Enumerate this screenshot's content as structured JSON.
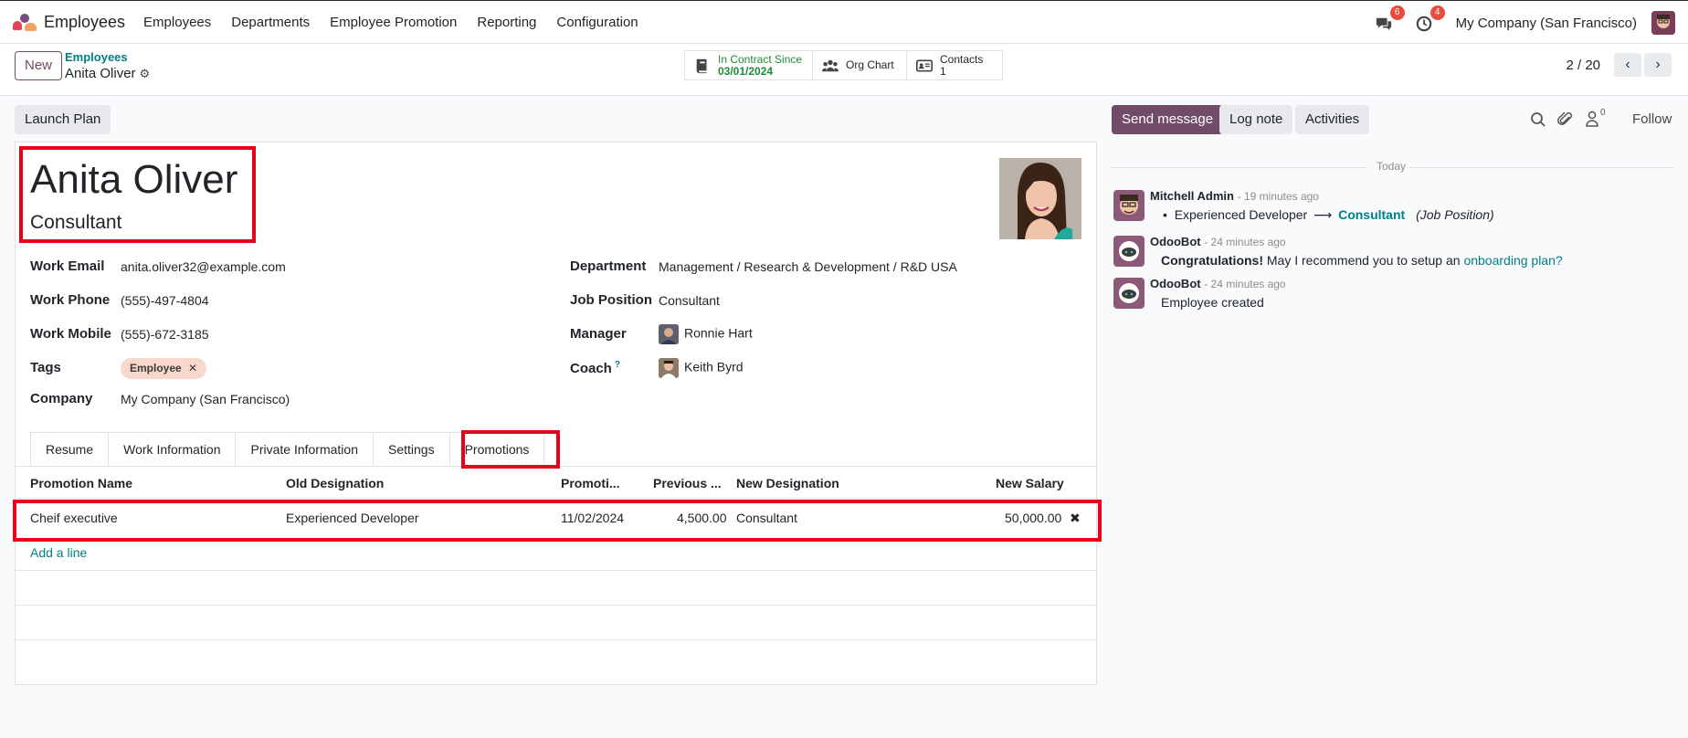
{
  "navbar": {
    "app_name": "Employees",
    "menu": [
      "Employees",
      "Departments",
      "Employee Promotion",
      "Reporting",
      "Configuration"
    ],
    "messages_badge": "6",
    "activities_badge": "4",
    "company": "My Company (San Francisco)"
  },
  "control": {
    "new_label": "New",
    "breadcrumb_parent": "Employees",
    "breadcrumb_current": "Anita Oliver",
    "smart_contract_label": "In Contract Since",
    "smart_contract_date": "03/01/2024",
    "smart_org_chart": "Org Chart",
    "smart_contacts_label": "Contacts",
    "smart_contacts_count": "1",
    "pager": "2 / 20"
  },
  "actions": {
    "launch_plan": "Launch Plan"
  },
  "employee": {
    "name": "Anita Oliver",
    "job_title": "Consultant"
  },
  "fields": {
    "work_email_label": "Work Email",
    "work_email": "anita.oliver32@example.com",
    "work_phone_label": "Work Phone",
    "work_phone": "(555)-497-4804",
    "work_mobile_label": "Work Mobile",
    "work_mobile": "(555)-672-3185",
    "tags_label": "Tags",
    "tag": "Employee",
    "company_label": "Company",
    "company": "My Company (San Francisco)",
    "department_label": "Department",
    "department": "Management / Research & Development / R&D USA",
    "job_position_label": "Job Position",
    "job_position": "Consultant",
    "manager_label": "Manager",
    "manager": "Ronnie Hart",
    "coach_label": "Coach",
    "coach": "Keith Byrd"
  },
  "tabs": [
    "Resume",
    "Work Information",
    "Private Information",
    "Settings",
    "Promotions"
  ],
  "promotions": {
    "headers": [
      "Promotion Name",
      "Old Designation",
      "Promoti...",
      "Previous ...",
      "New Designation",
      "New Salary"
    ],
    "rows": [
      [
        "Cheif executive",
        "Experienced Developer",
        "11/02/2024",
        "4,500.00",
        "Consultant",
        "50,000.00"
      ]
    ],
    "add_line": "Add a line"
  },
  "chatter": {
    "send_message": "Send message",
    "log_note": "Log note",
    "activities": "Activities",
    "followers_count": "0",
    "follow": "Follow",
    "date_separator": "Today",
    "messages": [
      {
        "author": "Mitchell Admin",
        "time": "- 19 minutes ago",
        "old_value": "Experienced Developer",
        "arrow": "⟶",
        "new_value": "Consultant",
        "field": "(Job Position)"
      },
      {
        "author": "OdooBot",
        "time": "- 24 minutes ago",
        "bold": "Congratulations!",
        "text": " May I recommend you to setup an ",
        "link": "onboarding plan?"
      },
      {
        "author": "OdooBot",
        "time": "- 24 minutes ago",
        "text": "Employee created"
      }
    ]
  },
  "colors": {
    "brand": "#714b67",
    "link": "#017e84",
    "highlight": "#e8001c",
    "badge": "#e74c3c"
  }
}
